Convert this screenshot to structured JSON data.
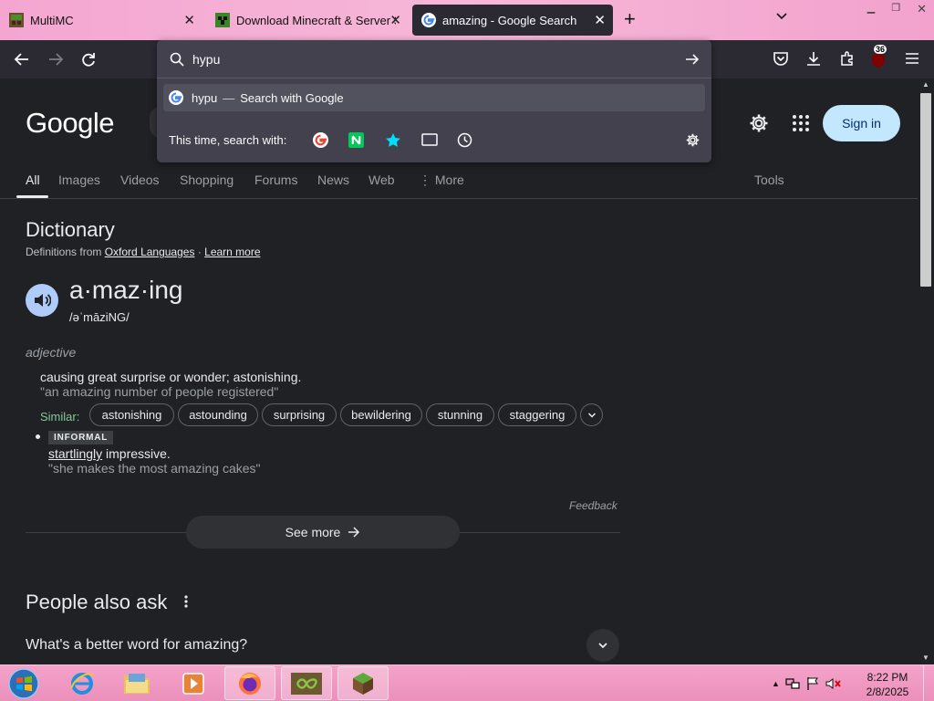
{
  "browser": {
    "tabs": [
      {
        "label": "MultiMC",
        "icon": "multimc-icon"
      },
      {
        "label": "Download Minecraft & Server Software",
        "icon": "minecraft-icon"
      },
      {
        "label": "amazing - Google Search",
        "icon": "google-icon",
        "active": true
      }
    ],
    "url_input": "hypu",
    "suggestion": {
      "query": "hypu",
      "dash": "—",
      "label": "Search with Google"
    },
    "one_off_label": "This time, search with:",
    "extension_badge": "36"
  },
  "google": {
    "logo": "Google",
    "signin": "Sign in",
    "tabs": [
      "All",
      "Images",
      "Videos",
      "Shopping",
      "Forums",
      "News",
      "Web",
      "More",
      "Tools"
    ]
  },
  "dictionary": {
    "heading": "Dictionary",
    "source_prefix": "Definitions from",
    "source_link": "Oxford Languages",
    "source_sep": "·",
    "learn_more": "Learn more",
    "word": "a·maz·ing",
    "phonetic": "/əˈmāziNG/",
    "part_of_speech": "adjective",
    "definition1": "causing great surprise or wonder; astonishing.",
    "example1": "\"an amazing number of people registered\"",
    "similar_label": "Similar:",
    "similar": [
      "astonishing",
      "astounding",
      "surprising",
      "bewildering",
      "stunning",
      "staggering"
    ],
    "informal_tag": "INFORMAL",
    "definition2_link": "startlingly",
    "definition2_rest": " impressive.",
    "example2": "\"she makes the most amazing cakes\"",
    "feedback": "Feedback",
    "see_more": "See more"
  },
  "people_also_ask": {
    "heading": "People also ask",
    "question1": "What's a better word for amazing?"
  },
  "taskbar": {
    "time": "8:22 PM",
    "date": "2/8/2025"
  },
  "colors": {
    "page_bg": "#202124",
    "chrome_bg": "#2b2a33",
    "signin_bg": "#c2e7ff",
    "taskbar_pink": "#eb8fbb"
  }
}
